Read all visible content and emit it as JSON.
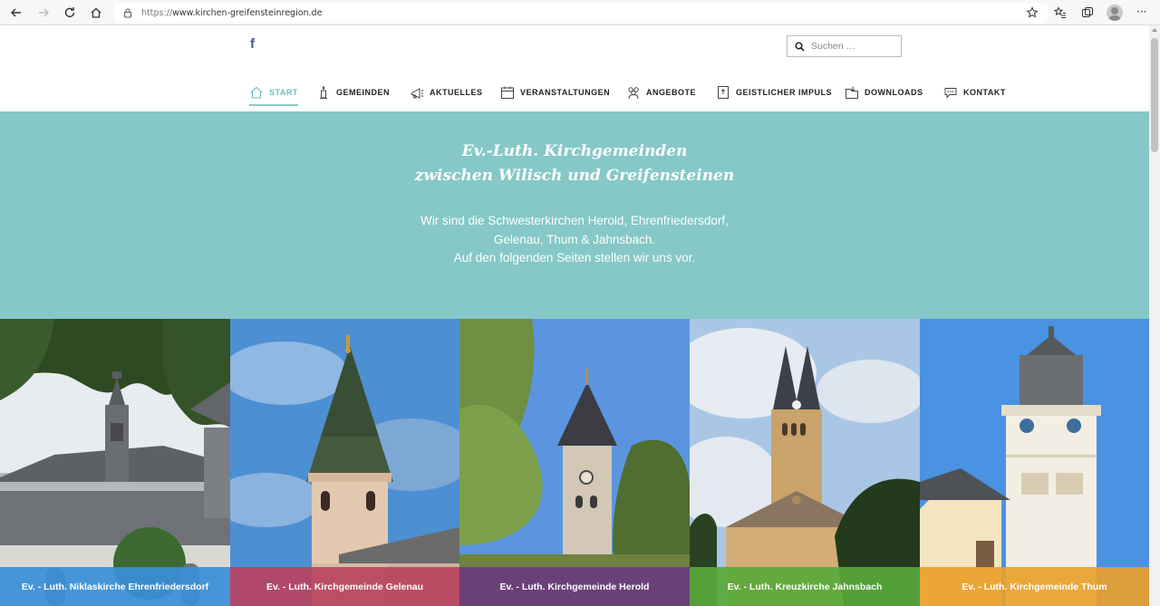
{
  "browser": {
    "url_prefix": "https://",
    "url_host": "www.kirchen-greifensteinregion.de",
    "menu_glyph": "···"
  },
  "header": {
    "facebook": "f",
    "search_placeholder": "Suchen …"
  },
  "nav": {
    "items": [
      {
        "label": "START",
        "icon": "home-icon",
        "active": true
      },
      {
        "label": "GEMEINDEN",
        "icon": "candle-icon"
      },
      {
        "label": "AKTUELLES",
        "icon": "megaphone-icon"
      },
      {
        "label": "VERANSTALTUNGEN",
        "icon": "calendar-icon"
      },
      {
        "label": "ANGEBOTE",
        "icon": "group-icon"
      },
      {
        "label": "GEISTLICHER IMPULS",
        "icon": "cross-card-icon"
      },
      {
        "label": "DOWNLOADS",
        "icon": "folder-icon"
      },
      {
        "label": "KONTAKT",
        "icon": "chat-icon"
      }
    ],
    "active_color": "#6fbcbc"
  },
  "hero": {
    "title_line1": "Ev.-Luth. Kirchgemeinden",
    "title_line2": "zwischen Wilisch und Greifensteinen",
    "text_line1": "Wir sind die Schwesterkirchen Herold, Ehrenfriedersdorf,",
    "text_line2": "Gelenau, Thum & Jahnsbach.",
    "text_line3": "Auf den folgenden Seiten stellen wir uns vor.",
    "background": "#85c8c7"
  },
  "tiles": [
    {
      "label": "Ev. - Luth. Niklaskirche Ehrenfriedersdorf",
      "color": "#3a8fd8"
    },
    {
      "label": "Ev. - Luth. Kirchgemeinde Gelenau",
      "color": "#b8435f"
    },
    {
      "label": "Ev. - Luth. Kirchgemeinde Herold",
      "color": "#6a3b7e"
    },
    {
      "label": "Ev. - Luth. Kreuzkirche Jahnsbach",
      "color": "#58a83a"
    },
    {
      "label": "Ev. - Luth. Kirchgemeinde Thum",
      "color": "#e9a12b"
    }
  ]
}
